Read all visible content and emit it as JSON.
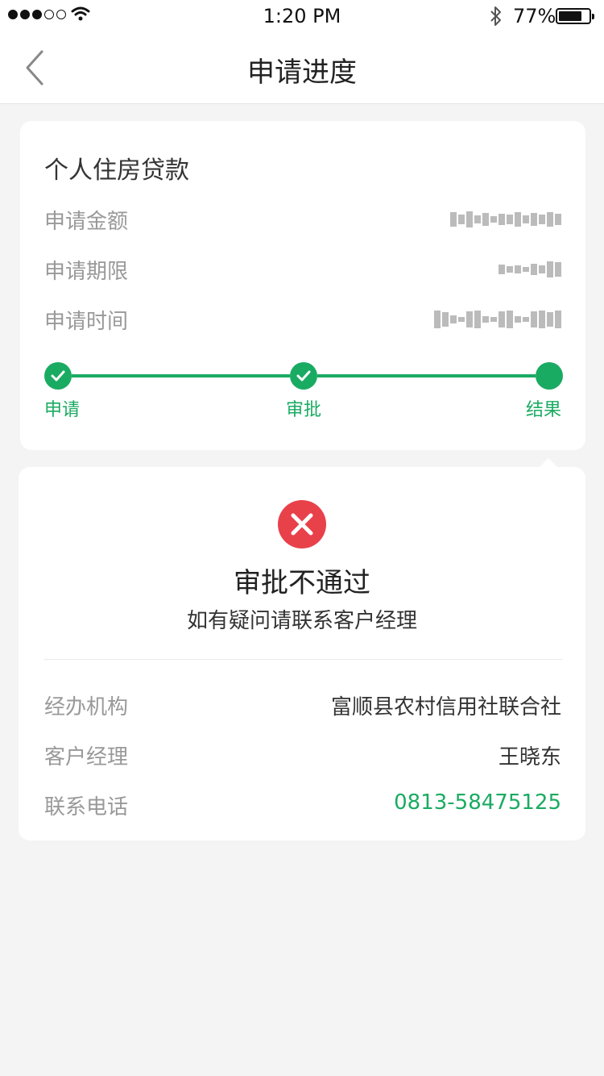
{
  "status_bar": {
    "time": "1:20 PM",
    "battery_percent": "77%",
    "battery_level": 0.77,
    "signal_bars_filled": 3,
    "signal_bars_total": 5
  },
  "nav": {
    "back_icon": "chevron-left-icon",
    "title": "申请进度"
  },
  "loan": {
    "title": "个人住房贷款",
    "rows": [
      {
        "label": "申请金额",
        "value": ""
      },
      {
        "label": "申请期限",
        "value": ""
      },
      {
        "label": "申请时间",
        "value": ""
      }
    ]
  },
  "progress": {
    "steps": [
      {
        "label": "申请",
        "status": "done"
      },
      {
        "label": "审批",
        "status": "done"
      },
      {
        "label": "结果",
        "status": "current"
      }
    ],
    "color": "#1aab62"
  },
  "result": {
    "icon": "close-circle-icon",
    "icon_color": "#e8414a",
    "title": "审批不通过",
    "subtitle": "如有疑问请联系客户经理",
    "details": [
      {
        "label": "经办机构",
        "value": "富顺县农村信用社联合社"
      },
      {
        "label": "客户经理",
        "value": "王晓东"
      },
      {
        "label": "联系电话",
        "value": "0813-58475125"
      }
    ]
  }
}
